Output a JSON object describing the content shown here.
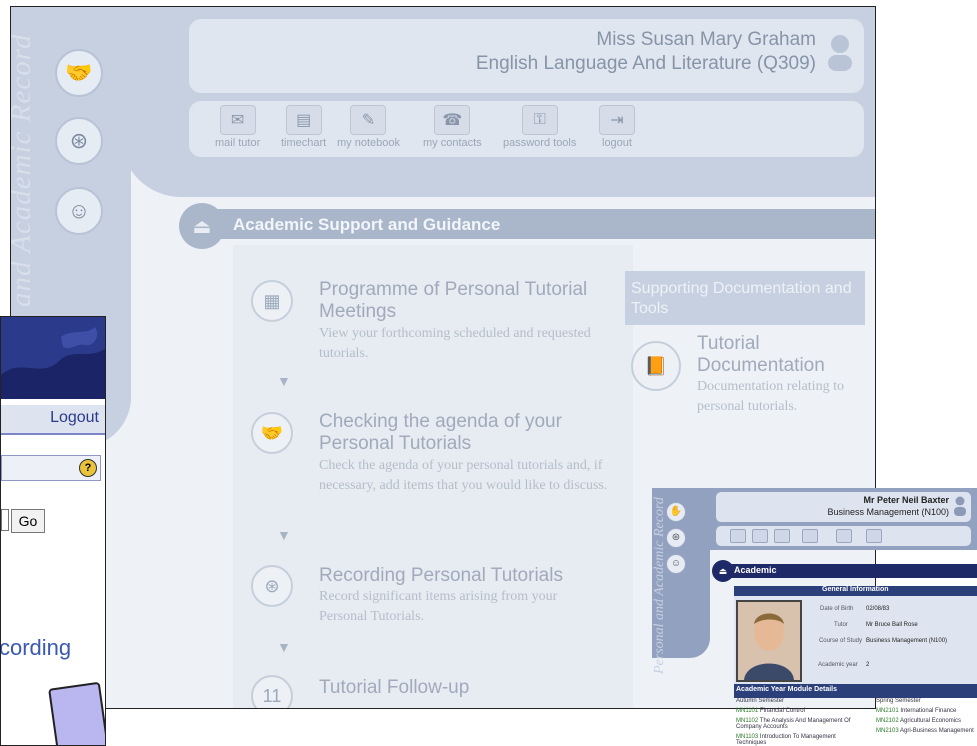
{
  "main": {
    "vertical_title": "and Academic Record",
    "user_name": "Miss Susan Mary Graham",
    "programme": "English Language And Literature (Q309)",
    "toolbar": [
      {
        "label": "mail tutor",
        "icon": "envelope-icon"
      },
      {
        "label": "timechart",
        "icon": "timechart-icon"
      },
      {
        "label": "my notebook",
        "icon": "notebook-icon"
      },
      {
        "label": "my contacts",
        "icon": "phone-icon"
      },
      {
        "label": "password tools",
        "icon": "password-tools-icon"
      },
      {
        "label": "logout",
        "icon": "door-icon"
      }
    ],
    "section_title": "Academic Support and Guidance",
    "items": [
      {
        "title": "Programme of Personal Tutorial Meetings",
        "desc": "View your forthcoming scheduled and requested tutorials.",
        "icon": "calendar-icon"
      },
      {
        "title": "Checking the agenda of your Personal Tutorials",
        "desc": "Check the agenda of your personal tutorials and, if necessary, add items that you would like to discuss.",
        "icon": "handshake-icon"
      },
      {
        "title": "Recording Personal Tutorials",
        "desc": "Record significant items arising from your Personal Tutorials.",
        "icon": "tape-icon"
      },
      {
        "title": "Tutorial Follow-up",
        "desc": "",
        "icon": "calendar-11-icon"
      }
    ],
    "docs_heading": "Supporting Documentation and Tools",
    "docs_item": {
      "title": "Tutorial Documentation",
      "desc": "Documentation relating to personal tutorials."
    }
  },
  "overlay_left": {
    "logout": "Logout",
    "go": "Go",
    "help": "?",
    "partial_text": "cording"
  },
  "overlay_right": {
    "vertical_title": "Personal and Academic Record",
    "name": "Mr Peter Neil Baxter",
    "programme": "Business Management (N100)",
    "section": "Academic",
    "general_info": "General Information",
    "fields": [
      {
        "label": "Date of Birth",
        "value": "02/08/83"
      },
      {
        "label": "Tutor",
        "value": "Mr Bruce Ball Rose"
      },
      {
        "label": "Course of Study",
        "value": "Business Management (N100)"
      },
      {
        "label": "Academic year",
        "value": "2"
      }
    ],
    "modules_title": "Academic Year Module Details",
    "autumn": "Autumn Semester",
    "spring": "Spring Semester",
    "modules_left": [
      {
        "code": "MN1101",
        "name": "Financial Control"
      },
      {
        "code": "MN1102",
        "name": "The Analysis And Management Of Company Accounts"
      },
      {
        "code": "MN1103",
        "name": "Introduction To Management Techniques"
      }
    ],
    "modules_right": [
      {
        "code": "MN2101",
        "name": "International Finance"
      },
      {
        "code": "MN2102",
        "name": "Agricultural Economics"
      },
      {
        "code": "MN2103",
        "name": "Agri-Business Management"
      }
    ]
  }
}
